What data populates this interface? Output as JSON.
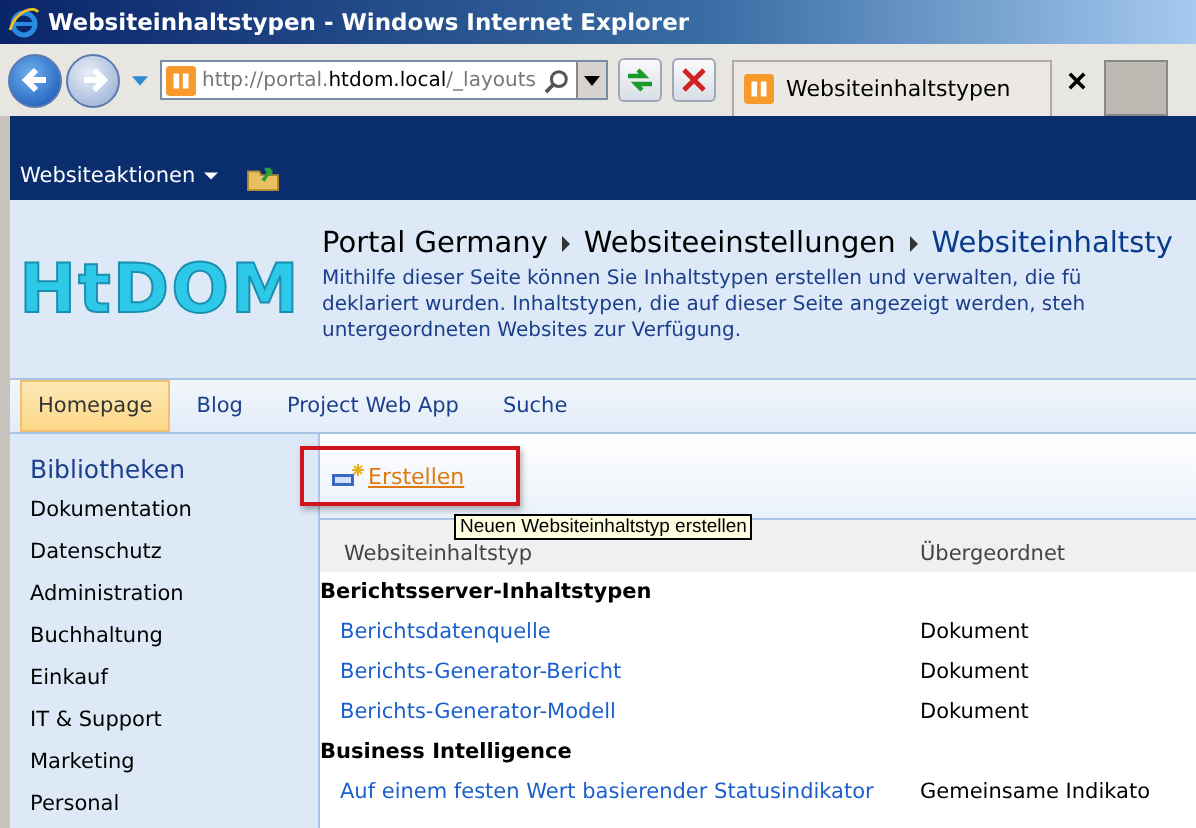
{
  "window": {
    "title": "Websiteinhaltstypen - Windows Internet Explorer"
  },
  "browser": {
    "address_prefix": "http://portal.",
    "address_host": "htdom.local",
    "address_path": "/_layouts",
    "tab_title": "Websiteinhaltstypen"
  },
  "ribbon": {
    "site_actions": "Websiteaktionen"
  },
  "header": {
    "logo": "HtDOM",
    "breadcrumb": [
      {
        "label": "Portal Germany",
        "current": false
      },
      {
        "label": "Websiteeinstellungen",
        "current": false
      },
      {
        "label": "Websiteinhaltsty",
        "current": true
      }
    ],
    "description_lines": [
      "Mithilfe dieser Seite können Sie Inhaltstypen erstellen und verwalten, die fü",
      "deklariert wurden. Inhaltstypen, die auf dieser Seite angezeigt werden, steh",
      "untergeordneten Websites zur Verfügung."
    ]
  },
  "nav": [
    {
      "label": "Homepage",
      "selected": true
    },
    {
      "label": "Blog",
      "selected": false
    },
    {
      "label": "Project Web App",
      "selected": false
    },
    {
      "label": "Suche",
      "selected": false
    }
  ],
  "sidebar": {
    "heading": "Bibliotheken",
    "items": [
      "Dokumentation",
      "Datenschutz",
      "Administration",
      "Buchhaltung",
      "Einkauf",
      "IT & Support",
      "Marketing",
      "Personal"
    ]
  },
  "toolbar": {
    "create": "Erstellen",
    "tooltip": "Neuen Websiteinhaltstyp erstellen"
  },
  "table": {
    "columns": [
      "Websiteinhaltstyp",
      "Übergeordnet"
    ],
    "groups": [
      {
        "name": "Berichtsserver-Inhaltstypen",
        "rows": [
          {
            "name": "Berichtsdatenquelle",
            "parent": "Dokument"
          },
          {
            "name": "Berichts-Generator-Bericht",
            "parent": "Dokument"
          },
          {
            "name": "Berichts-Generator-Modell",
            "parent": "Dokument"
          }
        ]
      },
      {
        "name": "Business Intelligence",
        "rows": [
          {
            "name": "Auf einem festen Wert basierender Statusindikator",
            "parent": "Gemeinsame Indikato"
          }
        ]
      }
    ]
  }
}
